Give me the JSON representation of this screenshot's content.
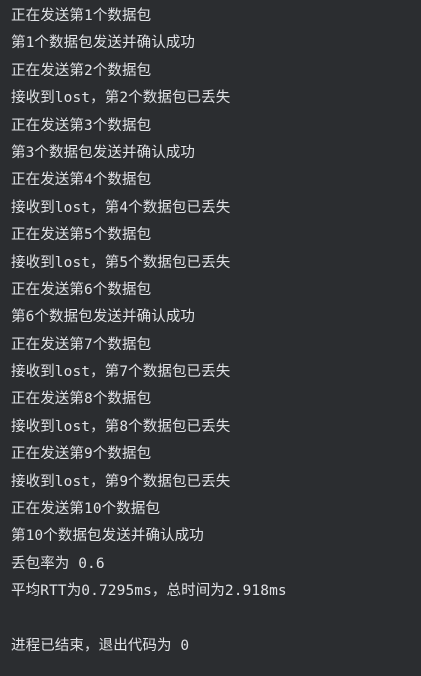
{
  "console": {
    "lines": [
      "正在发送第1个数据包",
      "第1个数据包发送并确认成功",
      "正在发送第2个数据包",
      "接收到lost，第2个数据包已丢失",
      "正在发送第3个数据包",
      "第3个数据包发送并确认成功",
      "正在发送第4个数据包",
      "接收到lost，第4个数据包已丢失",
      "正在发送第5个数据包",
      "接收到lost，第5个数据包已丢失",
      "正在发送第6个数据包",
      "第6个数据包发送并确认成功",
      "正在发送第7个数据包",
      "接收到lost，第7个数据包已丢失",
      "正在发送第8个数据包",
      "接收到lost，第8个数据包已丢失",
      "正在发送第9个数据包",
      "接收到lost，第9个数据包已丢失",
      "正在发送第10个数据包",
      "第10个数据包发送并确认成功",
      "丢包率为 0.6",
      "平均RTT为0.7295ms，总时间为2.918ms"
    ],
    "exit_message": "进程已结束，退出代码为 0"
  }
}
